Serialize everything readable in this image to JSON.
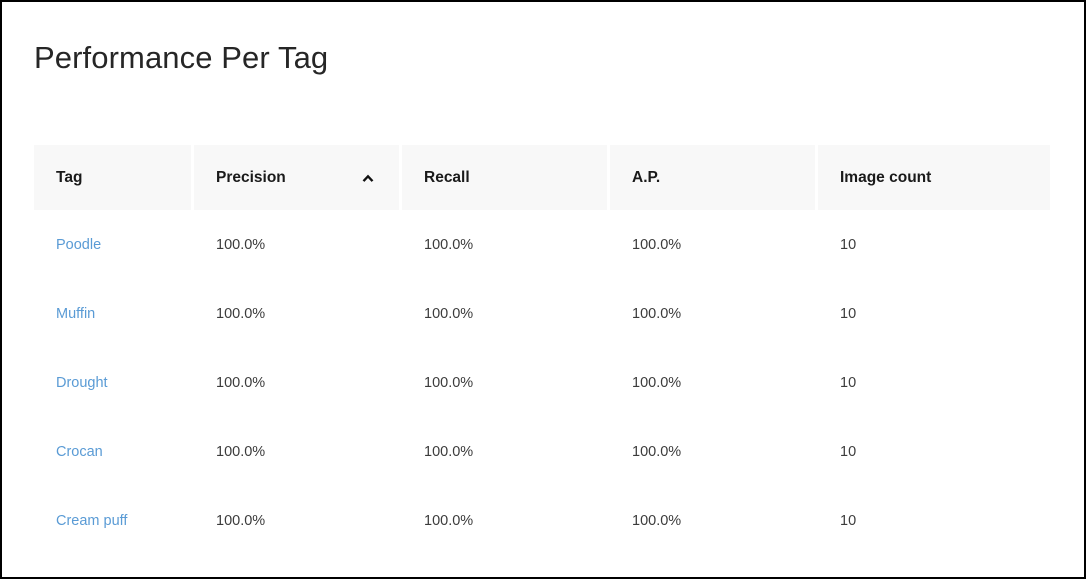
{
  "page": {
    "title": "Performance Per Tag",
    "accent_link_color": "#5a9bd5",
    "bar_color": "#fb0505",
    "header_bg_color": "#f8f8f8"
  },
  "table": {
    "columns": [
      {
        "key": "tag",
        "label": "Tag",
        "sorted": false,
        "sort_direction": ""
      },
      {
        "key": "precision",
        "label": "Precision",
        "sorted": true,
        "sort_direction": "ascending",
        "sort_icon": "chevron-up-icon"
      },
      {
        "key": "recall",
        "label": "Recall",
        "sorted": false,
        "sort_direction": ""
      },
      {
        "key": "ap",
        "label": "A.P.",
        "sorted": false,
        "sort_direction": ""
      },
      {
        "key": "image_count",
        "label": "Image count",
        "sorted": false,
        "sort_direction": ""
      }
    ],
    "rows": [
      {
        "tag": "Poodle",
        "precision": "100.0%",
        "recall": "100.0%",
        "ap": "100.0%",
        "image_count": "10",
        "bar_percent": 100
      },
      {
        "tag": "Muffin",
        "precision": "100.0%",
        "recall": "100.0%",
        "ap": "100.0%",
        "image_count": "10",
        "bar_percent": 100
      },
      {
        "tag": "Drought",
        "precision": "100.0%",
        "recall": "100.0%",
        "ap": "100.0%",
        "image_count": "10",
        "bar_percent": 100
      },
      {
        "tag": "Crocan",
        "precision": "100.0%",
        "recall": "100.0%",
        "ap": "100.0%",
        "image_count": "10",
        "bar_percent": 100
      },
      {
        "tag": "Cream puff",
        "precision": "100.0%",
        "recall": "100.0%",
        "ap": "100.0%",
        "image_count": "10",
        "bar_percent": 100
      }
    ]
  },
  "chart_data": {
    "type": "table",
    "title": "Performance Per Tag",
    "columns": [
      "Tag",
      "Precision",
      "Recall",
      "A.P.",
      "Image count"
    ],
    "categories": [
      "Poodle",
      "Muffin",
      "Drought",
      "Crocan",
      "Cream puff"
    ],
    "series": [
      {
        "name": "Precision",
        "values": [
          100.0,
          100.0,
          100.0,
          100.0,
          100.0
        ],
        "unit": "%"
      },
      {
        "name": "Recall",
        "values": [
          100.0,
          100.0,
          100.0,
          100.0,
          100.0
        ],
        "unit": "%"
      },
      {
        "name": "A.P.",
        "values": [
          100.0,
          100.0,
          100.0,
          100.0,
          100.0
        ],
        "unit": "%"
      },
      {
        "name": "Image count",
        "values": [
          10,
          10,
          10,
          10,
          10
        ],
        "unit": ""
      }
    ],
    "bar_series": {
      "name": "Image count",
      "values": [
        10,
        10,
        10,
        10,
        10
      ],
      "max": 10,
      "color": "#fb0505"
    },
    "sorted_by": "Precision",
    "sort_direction": "ascending",
    "xlabel": "",
    "ylabel": ""
  }
}
